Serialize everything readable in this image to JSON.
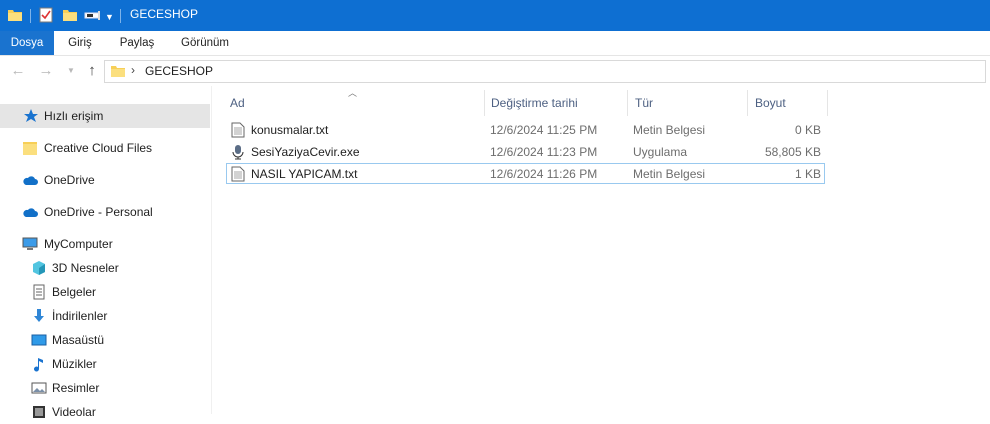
{
  "window": {
    "title": "GECESHOP"
  },
  "ribbon": {
    "tabs": [
      "Dosya",
      "Giriş",
      "Paylaş",
      "Görünüm"
    ]
  },
  "address": {
    "path": "GECESHOP"
  },
  "sidebar": {
    "items": [
      {
        "label": "Hızlı erişim",
        "icon": "star-icon"
      },
      {
        "label": "Creative Cloud Files",
        "icon": "folder-icon"
      },
      {
        "label": "OneDrive",
        "icon": "cloud-icon"
      },
      {
        "label": "OneDrive - Personal",
        "icon": "cloud-icon"
      },
      {
        "label": "MyComputer",
        "icon": "computer-icon"
      },
      {
        "label": "3D Nesneler",
        "icon": "cube-icon"
      },
      {
        "label": "Belgeler",
        "icon": "document-icon"
      },
      {
        "label": "İndirilenler",
        "icon": "download-icon"
      },
      {
        "label": "Masaüstü",
        "icon": "desktop-icon"
      },
      {
        "label": "Müzikler",
        "icon": "music-icon"
      },
      {
        "label": "Resimler",
        "icon": "pictures-icon"
      },
      {
        "label": "Videolar",
        "icon": "video-icon"
      }
    ]
  },
  "columns": {
    "name": "Ad",
    "date": "Değiştirme tarihi",
    "type": "Tür",
    "size": "Boyut"
  },
  "files": [
    {
      "name": "konusmalar.txt",
      "date": "12/6/2024 11:25 PM",
      "type": "Metin Belgesi",
      "size": "0 KB",
      "icon": "text-file-icon"
    },
    {
      "name": "SesiYaziyaCevir.exe",
      "date": "12/6/2024 11:23 PM",
      "type": "Uygulama",
      "size": "58,805 KB",
      "icon": "microphone-icon"
    },
    {
      "name": "NASIL YAPICAM.txt",
      "date": "12/6/2024 11:26 PM",
      "type": "Metin Belgesi",
      "size": "1 KB",
      "icon": "text-file-icon"
    }
  ],
  "colors": {
    "titlebar": "#0e6fd2",
    "active_tab": "#1a73cf",
    "folder": "#f7cf57",
    "onedrive": "#1270c8"
  }
}
